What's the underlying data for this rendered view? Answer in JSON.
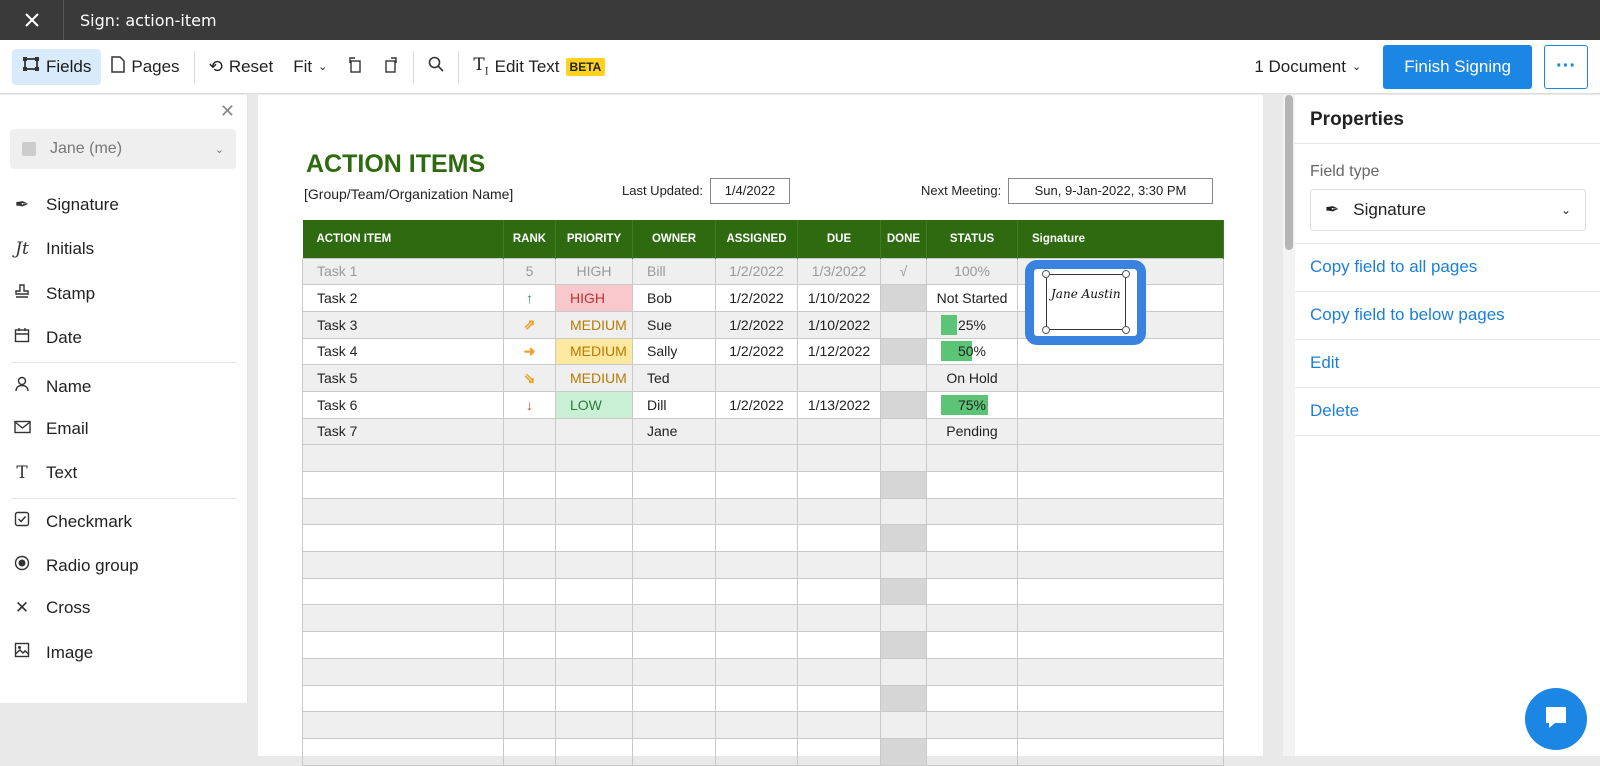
{
  "window": {
    "title": "Sign: action-item"
  },
  "toolbar": {
    "fields": "Fields",
    "pages": "Pages",
    "reset": "Reset",
    "fit": "Fit",
    "edit_text": "Edit Text",
    "beta": "BETA",
    "documents": "1 Document",
    "finish": "Finish Signing",
    "more": "···"
  },
  "left_panel": {
    "signer": "Jane (me)",
    "fields": [
      {
        "label": "Signature",
        "icon": "pen-nib-icon"
      },
      {
        "label": "Initials",
        "icon": "initials-icon"
      },
      {
        "label": "Stamp",
        "icon": "stamp-icon"
      },
      {
        "label": "Date",
        "icon": "calendar-icon"
      },
      {
        "label": "Name",
        "icon": "person-icon"
      },
      {
        "label": "Email",
        "icon": "envelope-icon"
      },
      {
        "label": "Text",
        "icon": "text-icon"
      },
      {
        "label": "Checkmark",
        "icon": "checkbox-icon"
      },
      {
        "label": "Radio group",
        "icon": "radio-icon"
      },
      {
        "label": "Cross",
        "icon": "cross-icon"
      },
      {
        "label": "Image",
        "icon": "image-icon"
      }
    ]
  },
  "document": {
    "title": "ACTION ITEMS",
    "org": "[Group/Team/Organization Name]",
    "last_updated_label": "Last Updated:",
    "last_updated": "1/4/2022",
    "next_meeting_label": "Next Meeting:",
    "next_meeting": "Sun, 9-Jan-2022, 3:30 PM",
    "headers": [
      "ACTION ITEM",
      "RANK",
      "PRIORITY",
      "OWNER",
      "ASSIGNED",
      "DUE",
      "DONE",
      "STATUS",
      "Signature"
    ],
    "rows": [
      {
        "item": "Task 1",
        "rank": "5",
        "priority": "HIGH",
        "owner": "Bill",
        "assigned": "1/2/2022",
        "due": "1/3/2022",
        "done": "√",
        "status": "100%"
      },
      {
        "item": "Task 2",
        "rank": "↑",
        "priority": "HIGH",
        "owner": "Bob",
        "assigned": "1/2/2022",
        "due": "1/10/2022",
        "done": "",
        "status": "Not Started"
      },
      {
        "item": "Task 3",
        "rank": "⇗",
        "priority": "MEDIUM",
        "owner": "Sue",
        "assigned": "1/2/2022",
        "due": "1/10/2022",
        "done": "",
        "status": "25%",
        "progress": 0.25
      },
      {
        "item": "Task 4",
        "rank": "➜",
        "priority": "MEDIUM",
        "owner": "Sally",
        "assigned": "1/2/2022",
        "due": "1/12/2022",
        "done": "",
        "status": "50%",
        "progress": 0.5
      },
      {
        "item": "Task 5",
        "rank": "⇘",
        "priority": "MEDIUM",
        "owner": "Ted",
        "assigned": "",
        "due": "",
        "done": "",
        "status": "On Hold"
      },
      {
        "item": "Task 6",
        "rank": "↓",
        "priority": "LOW",
        "owner": "Dill",
        "assigned": "1/2/2022",
        "due": "1/13/2022",
        "done": "",
        "status": "75%",
        "progress": 0.75
      },
      {
        "item": "Task 7",
        "rank": "",
        "priority": "",
        "owner": "Jane",
        "assigned": "",
        "due": "",
        "done": "",
        "status": "Pending"
      }
    ],
    "signature_text": "Jane Austin"
  },
  "right_panel": {
    "title": "Properties",
    "field_type_label": "Field type",
    "field_type": "Signature",
    "links": [
      "Copy field to all pages",
      "Copy field to below pages",
      "Edit",
      "Delete"
    ]
  },
  "colors": {
    "accent": "#1b86e3",
    "table_header": "#2d6a10",
    "progress": "#5cc476"
  }
}
